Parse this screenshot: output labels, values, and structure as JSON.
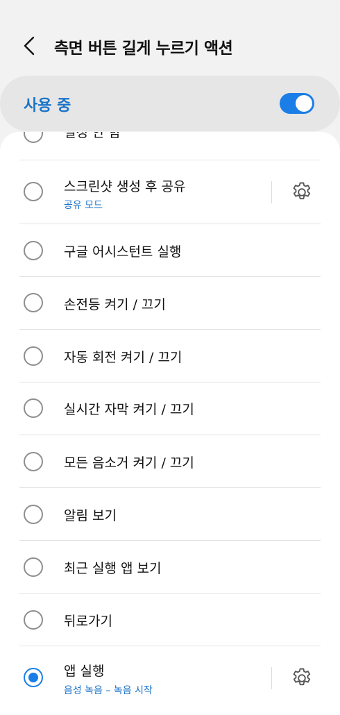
{
  "header": {
    "title": "측면 버튼 길게 누르기 액션",
    "back_icon": "chevron-left-icon"
  },
  "master": {
    "label": "사용 중",
    "enabled": true,
    "accent_color": "#1a7ee6"
  },
  "options": [
    {
      "label": "설정 안 함",
      "sub": "",
      "checked": false,
      "has_settings": false
    },
    {
      "label": "스크린샷 생성 후 공유",
      "sub": "공유 모드",
      "checked": false,
      "has_settings": true
    },
    {
      "label": "구글 어시스턴트 실행",
      "sub": "",
      "checked": false,
      "has_settings": false
    },
    {
      "label": "손전등 켜기 / 끄기",
      "sub": "",
      "checked": false,
      "has_settings": false
    },
    {
      "label": "자동 회전 켜기 / 끄기",
      "sub": "",
      "checked": false,
      "has_settings": false
    },
    {
      "label": "실시간 자막 켜기 / 끄기",
      "sub": "",
      "checked": false,
      "has_settings": false
    },
    {
      "label": "모든 음소거 켜기 / 끄기",
      "sub": "",
      "checked": false,
      "has_settings": false
    },
    {
      "label": "알림 보기",
      "sub": "",
      "checked": false,
      "has_settings": false
    },
    {
      "label": "최근 실행 앱 보기",
      "sub": "",
      "checked": false,
      "has_settings": false
    },
    {
      "label": "뒤로가기",
      "sub": "",
      "checked": false,
      "has_settings": false
    },
    {
      "label": "앱 실행",
      "sub": "음성 녹음 – 녹음 시작",
      "checked": true,
      "has_settings": true
    }
  ]
}
